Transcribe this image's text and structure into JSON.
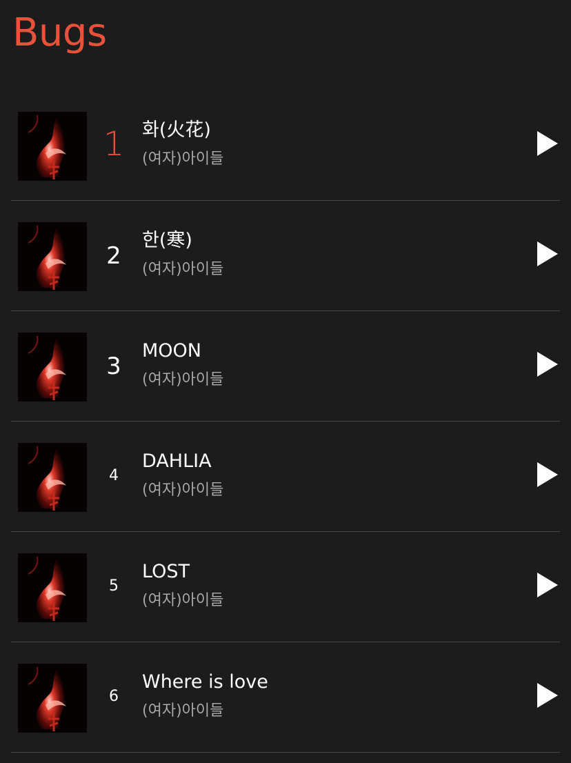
{
  "app": {
    "title": "Bugs",
    "accent_color": "#e8523a"
  },
  "tracks": [
    {
      "rank": "1",
      "title": "화(火花)",
      "artist": "(여자)아이들"
    },
    {
      "rank": "2",
      "title": "한(寒)",
      "artist": "(여자)아이들"
    },
    {
      "rank": "3",
      "title": "MOON",
      "artist": "(여자)아이들"
    },
    {
      "rank": "4",
      "title": "DAHLIA",
      "artist": "(여자)아이들"
    },
    {
      "rank": "5",
      "title": "LOST",
      "artist": "(여자)아이들"
    },
    {
      "rank": "6",
      "title": "Where is love",
      "artist": "(여자)아이들"
    }
  ],
  "icons": {
    "play": "play-icon",
    "album_art": "album-art-flame"
  }
}
